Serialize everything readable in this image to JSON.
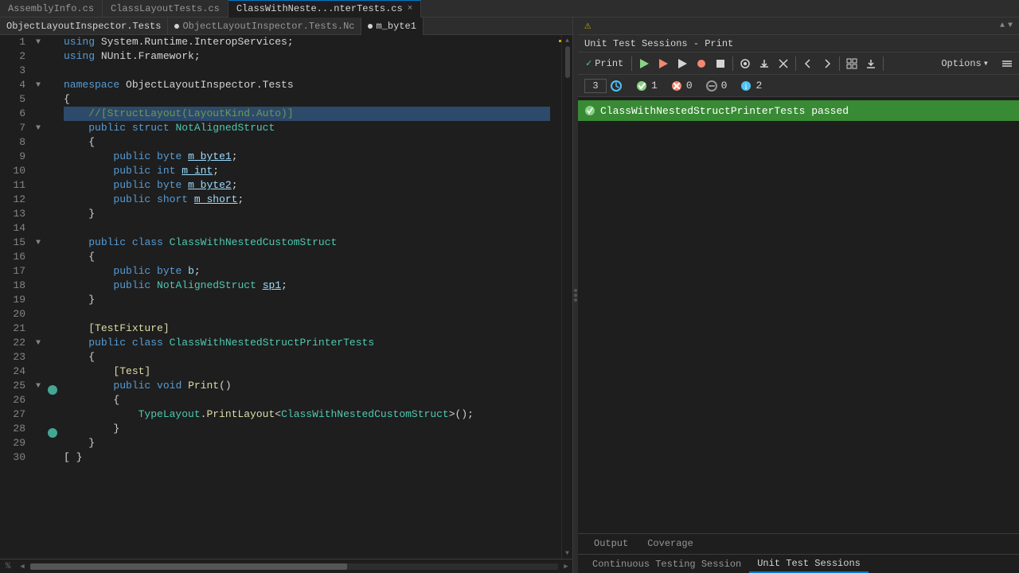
{
  "tabs": [
    {
      "label": "AssemblyInfo.cs",
      "active": false,
      "modified": false
    },
    {
      "label": "ClassLayoutTests.cs",
      "active": false,
      "modified": false
    },
    {
      "label": "ClassWithNeste...nterTests.cs",
      "active": true,
      "modified": false
    },
    {
      "label": "×",
      "active": false,
      "modified": false
    }
  ],
  "editor": {
    "filename": "ObjectLayoutInspector.Tests",
    "subtabs": [
      {
        "label": "ObjectLayoutInspector.Tests.Nc",
        "active": false,
        "dot": true
      },
      {
        "label": "m_byte1",
        "active": true,
        "dot": false
      }
    ],
    "lines": [
      {
        "num": 1,
        "indent": 0,
        "collapse": true,
        "bp": false,
        "content": "using System.Runtime.InteropServices;"
      },
      {
        "num": 2,
        "indent": 0,
        "collapse": false,
        "bp": false,
        "content": "using NUnit.Framework;"
      },
      {
        "num": 3,
        "indent": 0,
        "collapse": false,
        "bp": false,
        "content": ""
      },
      {
        "num": 4,
        "indent": 0,
        "collapse": true,
        "bp": false,
        "content": "namespace ObjectLayoutInspector.Tests"
      },
      {
        "num": 5,
        "indent": 0,
        "collapse": false,
        "bp": false,
        "content": "{"
      },
      {
        "num": 6,
        "indent": 1,
        "collapse": false,
        "bp": false,
        "content": "    //[StructLayout(LayoutKind.Auto)]",
        "highlight": true
      },
      {
        "num": 7,
        "indent": 1,
        "collapse": true,
        "bp": false,
        "content": "    public struct NotAlignedStruct"
      },
      {
        "num": 8,
        "indent": 1,
        "collapse": false,
        "bp": false,
        "content": "    {"
      },
      {
        "num": 9,
        "indent": 2,
        "collapse": false,
        "bp": false,
        "content": "        public byte m_byte1;"
      },
      {
        "num": 10,
        "indent": 2,
        "collapse": false,
        "bp": false,
        "content": "        public int m_int;"
      },
      {
        "num": 11,
        "indent": 2,
        "collapse": false,
        "bp": false,
        "content": "        public byte m_byte2;"
      },
      {
        "num": 12,
        "indent": 2,
        "collapse": false,
        "bp": false,
        "content": "        public short m_short;"
      },
      {
        "num": 13,
        "indent": 1,
        "collapse": false,
        "bp": false,
        "content": "    }"
      },
      {
        "num": 14,
        "indent": 0,
        "collapse": false,
        "bp": false,
        "content": ""
      },
      {
        "num": 15,
        "indent": 1,
        "collapse": true,
        "bp": false,
        "content": "    public class ClassWithNestedCustomStruct"
      },
      {
        "num": 16,
        "indent": 1,
        "collapse": false,
        "bp": false,
        "content": "    {"
      },
      {
        "num": 17,
        "indent": 2,
        "collapse": false,
        "bp": false,
        "content": "        public byte b;"
      },
      {
        "num": 18,
        "indent": 2,
        "collapse": false,
        "bp": false,
        "content": "        public NotAlignedStruct sp1;"
      },
      {
        "num": 19,
        "indent": 1,
        "collapse": false,
        "bp": false,
        "content": "    }"
      },
      {
        "num": 20,
        "indent": 0,
        "collapse": false,
        "bp": false,
        "content": ""
      },
      {
        "num": 21,
        "indent": 1,
        "collapse": false,
        "bp": false,
        "content": "    [TestFixture]"
      },
      {
        "num": 22,
        "indent": 1,
        "collapse": true,
        "bp": true,
        "content": "    public class ClassWithNestedStructPrinterTests"
      },
      {
        "num": 23,
        "indent": 1,
        "collapse": false,
        "bp": false,
        "content": "    {"
      },
      {
        "num": 24,
        "indent": 2,
        "collapse": false,
        "bp": false,
        "content": "        [Test]"
      },
      {
        "num": 25,
        "indent": 2,
        "collapse": true,
        "bp": true,
        "content": "        public void Print()"
      },
      {
        "num": 26,
        "indent": 2,
        "collapse": false,
        "bp": false,
        "content": "        {"
      },
      {
        "num": 27,
        "indent": 3,
        "collapse": false,
        "bp": false,
        "content": "            TypeLayout.PrintLayout<ClassWithNestedCustomStruct>();"
      },
      {
        "num": 28,
        "indent": 2,
        "collapse": false,
        "bp": false,
        "content": "        }"
      },
      {
        "num": 29,
        "indent": 1,
        "collapse": false,
        "bp": false,
        "content": "    }"
      },
      {
        "num": 30,
        "indent": 0,
        "collapse": false,
        "bp": false,
        "content": "[ }"
      }
    ]
  },
  "testPanel": {
    "title": "Unit Test Sessions - Print",
    "toolbar": {
      "print_label": "Print",
      "options_label": "Options",
      "options_arrow": "▾"
    },
    "stats": {
      "running": "3",
      "passed": "1",
      "failed": "0",
      "skipped": "0",
      "info": "2"
    },
    "results": [
      {
        "label": "ClassWithNestedStructPrinterTests passed",
        "status": "passed"
      }
    ]
  },
  "bottomPanel": {
    "tabs": [
      {
        "label": "Output",
        "active": false
      },
      {
        "label": "Coverage",
        "active": false
      }
    ],
    "sessionTabs": [
      {
        "label": "Continuous Testing Session",
        "active": false
      },
      {
        "label": "Unit Test Sessions",
        "active": true
      }
    ]
  },
  "statusBar": {
    "zoom": "%",
    "arrows": "◀ ▶"
  }
}
